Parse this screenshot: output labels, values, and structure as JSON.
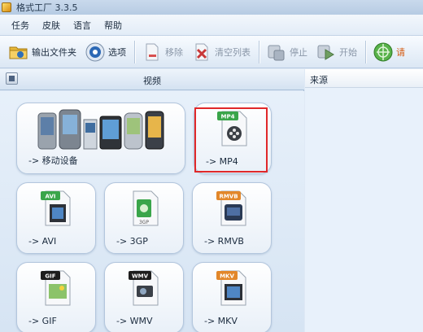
{
  "window": {
    "title": "格式工厂 3.3.5"
  },
  "menu": [
    "任务",
    "皮肤",
    "语言",
    "帮助"
  ],
  "toolbar": {
    "output_folder": "输出文件夹",
    "options": "选项",
    "remove": "移除",
    "clear_list": "清空列表",
    "stop": "停止",
    "start": "开始",
    "partial": "请"
  },
  "left_panel": {
    "header": "视频",
    "tiles": [
      {
        "label": "-> 移动设备",
        "badge": "",
        "badge_color": "",
        "icon": "mobile-devices-icon"
      },
      {
        "label": "-> MP4",
        "badge": "MP4",
        "badge_color": "#3aa54a",
        "icon": "mp4-file-icon"
      },
      {
        "label": "-> AVI",
        "badge": "AVI",
        "badge_color": "#3aa54a",
        "icon": "avi-file-icon"
      },
      {
        "label": "-> 3GP",
        "badge": "3GP",
        "badge_color": "#3aa54a",
        "icon": "3gp-file-icon"
      },
      {
        "label": "-> RMVB",
        "badge": "RMVB",
        "badge_color": "#e2872a",
        "icon": "rmvb-file-icon"
      },
      {
        "label": "-> GIF",
        "badge": "GIF",
        "badge_color": "#1d1d1d",
        "icon": "gif-file-icon"
      },
      {
        "label": "-> WMV",
        "badge": "WMV",
        "badge_color": "#1d1d1d",
        "icon": "wmv-file-icon"
      },
      {
        "label": "-> MKV",
        "badge": "MKV",
        "badge_color": "#e2872a",
        "icon": "mkv-file-icon"
      }
    ]
  },
  "right_panel": {
    "column_header": "来源"
  },
  "colors": {
    "highlight": "#e0282a",
    "panel_bg": "#dce8f5"
  }
}
